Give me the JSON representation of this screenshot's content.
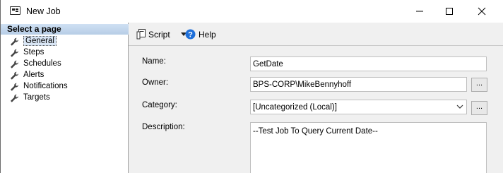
{
  "window": {
    "title": "New Job"
  },
  "left_pane": {
    "header": "Select a page",
    "items": [
      {
        "label": "General",
        "selected": true
      },
      {
        "label": "Steps"
      },
      {
        "label": "Schedules"
      },
      {
        "label": "Alerts"
      },
      {
        "label": "Notifications"
      },
      {
        "label": "Targets"
      }
    ]
  },
  "toolbar": {
    "script_label": "Script",
    "help_label": "Help"
  },
  "form": {
    "name_label": "Name:",
    "name_value": "GetDate",
    "owner_label": "Owner:",
    "owner_value": "BPS-CORP\\MikeBennyhoff",
    "category_label": "Category:",
    "category_value": "[Uncategorized (Local)]",
    "description_label": "Description:",
    "description_value": "--Test Job To Query Current Date--",
    "browse_label": "..."
  },
  "colors": {
    "header_bg": "#c6d9ef",
    "help_icon": "#1e6fd9"
  }
}
